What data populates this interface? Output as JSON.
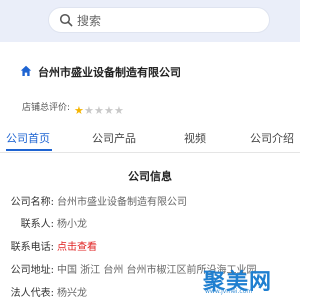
{
  "search": {
    "placeholder": "搜索"
  },
  "company": {
    "name": "台州市盛业设备制造有限公司"
  },
  "rating": {
    "label": "店铺总评价:",
    "stars_filled": 1,
    "stars_total": 5,
    "star_color": "#f5b400",
    "star_empty_color": "#c8c8c8"
  },
  "tabs": [
    {
      "label": "公司首页",
      "active": true
    },
    {
      "label": "公司产品",
      "active": false
    },
    {
      "label": "视频",
      "active": false
    },
    {
      "label": "公司介绍",
      "active": false
    }
  ],
  "info": {
    "title": "公司信息",
    "rows": [
      {
        "label": "公司名称:",
        "value": "台州市盛业设备制造有限公司"
      },
      {
        "label": "联系人:",
        "value": "杨小龙"
      },
      {
        "label": "联系电话:",
        "value": "点击查看"
      },
      {
        "label": "公司地址:",
        "value": "中国 浙江 台州 台州市椒江区前所沿海工业园"
      },
      {
        "label": "法人代表:",
        "value": "杨兴龙"
      }
    ]
  },
  "watermark": {
    "text": "聚美网",
    "subtext": "www.jvmei.com"
  },
  "colors": {
    "accent": "#1e64d2",
    "link_red": "#e02020",
    "header_bg": "#eaeef9"
  }
}
